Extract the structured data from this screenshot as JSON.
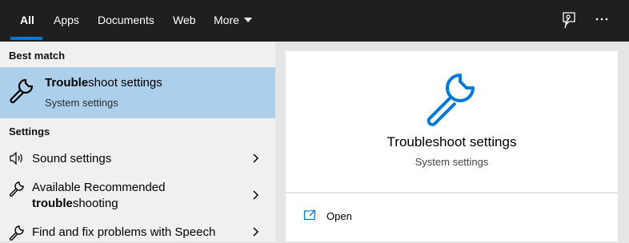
{
  "tabs": [
    {
      "label": "All",
      "active": true
    },
    {
      "label": "Apps"
    },
    {
      "label": "Documents"
    },
    {
      "label": "Web"
    },
    {
      "label": "More"
    }
  ],
  "toolbar": {
    "feedback_icon": "feedback-icon",
    "more_icon": "ellipsis-icon"
  },
  "accent_color": "#0078d7",
  "highlight_color": "#acd0ec",
  "best_match": {
    "header": "Best match",
    "title_bold": "Trouble",
    "title_rest": "shoot settings",
    "subtitle": "System settings",
    "icon": "wrench-icon"
  },
  "settings": {
    "header": "Settings",
    "items": [
      {
        "icon": "speaker-icon",
        "line1": "Sound settings"
      },
      {
        "icon": "wrench-icon",
        "line1": "Available Recommended",
        "line2_bold": "trouble",
        "line2_rest": "shooting"
      },
      {
        "icon": "wrench-icon",
        "line1": "Find and fix problems with Speech"
      }
    ]
  },
  "detail": {
    "icon": "wrench-icon",
    "title": "Troubleshoot settings",
    "subtitle": "System settings",
    "actions": [
      {
        "icon": "open-icon",
        "label": "Open"
      }
    ]
  }
}
